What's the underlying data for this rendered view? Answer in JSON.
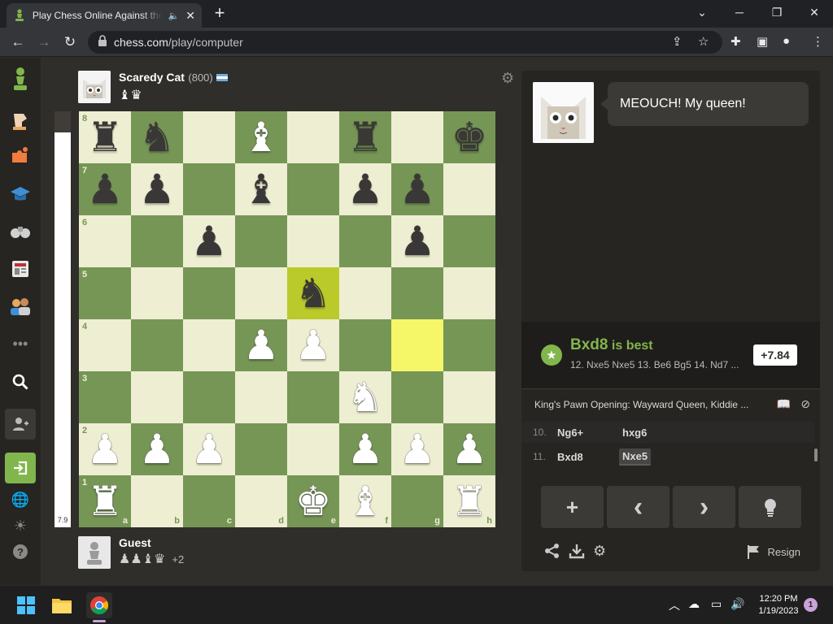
{
  "browser": {
    "tab_title": "Play Chess Online Against the Computer",
    "url_host": "chess.com",
    "url_path": "/play/computer",
    "new_tab_glyph": "+",
    "icons": [
      "back-icon",
      "forward-icon",
      "reload-icon",
      "lock-icon",
      "share-icon",
      "star-icon",
      "extensions-icon",
      "sidepanel-icon",
      "profile-icon",
      "menu-icon"
    ]
  },
  "sidebar": {
    "items": [
      "chess-logo",
      "play",
      "puzzles",
      "learn",
      "watch",
      "news",
      "social",
      "more",
      "search",
      "add-friend",
      "sign-in",
      "language",
      "theme",
      "help"
    ]
  },
  "opponent": {
    "name": "Scaredy Cat",
    "rating": "(800)",
    "captured": "♝♛"
  },
  "player": {
    "name": "Guest",
    "captured": "♟♟♝♛",
    "advantage": "+2"
  },
  "eval_bar": {
    "label": "7.9",
    "white_fraction": 0.95
  },
  "board": {
    "files": [
      "a",
      "b",
      "c",
      "d",
      "e",
      "f",
      "g",
      "h"
    ],
    "ranks": [
      "8",
      "7",
      "6",
      "5",
      "4",
      "3",
      "2",
      "1"
    ],
    "highlight": [
      "e5",
      "g4"
    ],
    "pieces": {
      "a8": "br",
      "b8": "bn",
      "d8": "wb",
      "f8": "br",
      "h8": "bk",
      "a7": "bp",
      "b7": "bp",
      "d7": "bb",
      "f7": "bp",
      "g7": "bp",
      "c6": "bp",
      "g6": "bp",
      "e5": "bn",
      "d4": "wp",
      "e4": "wp",
      "f3": "wn",
      "a2": "wp",
      "b2": "wp",
      "c2": "wp",
      "f2": "wp",
      "g2": "wp",
      "h2": "wp",
      "a1": "wr",
      "e1": "wk",
      "f1": "wb",
      "h1": "wr"
    }
  },
  "coach": {
    "message": "MEOUCH! My queen!"
  },
  "analysis": {
    "best_move": "Bxd8",
    "best_suffix": " is best",
    "line": "12. Nxe5 Nxe5 13. Be6 Bg5 14. Nd7 ...",
    "evaluation": "+7.84"
  },
  "opening": {
    "name": "King's Pawn Opening: Wayward Queen, Kiddie ..."
  },
  "moves": [
    {
      "num": "10.",
      "white": "Ng6+",
      "black": "hxg6"
    },
    {
      "num": "11.",
      "white": "Bxd8",
      "black": "Nxe5"
    }
  ],
  "controls": {
    "new": "+",
    "prev": "‹",
    "next": "›",
    "hint": "hint"
  },
  "footer": {
    "resign_label": "Resign"
  },
  "taskbar": {
    "time": "12:20 PM",
    "date": "1/19/2023",
    "notifications": "1"
  },
  "colors": {
    "board_light": "#eeeed2",
    "board_dark": "#769656",
    "highlight_light": "#f6f669",
    "highlight_dark": "#baca2b",
    "best_green": "#81b64c",
    "page_bg": "#302e2b"
  }
}
